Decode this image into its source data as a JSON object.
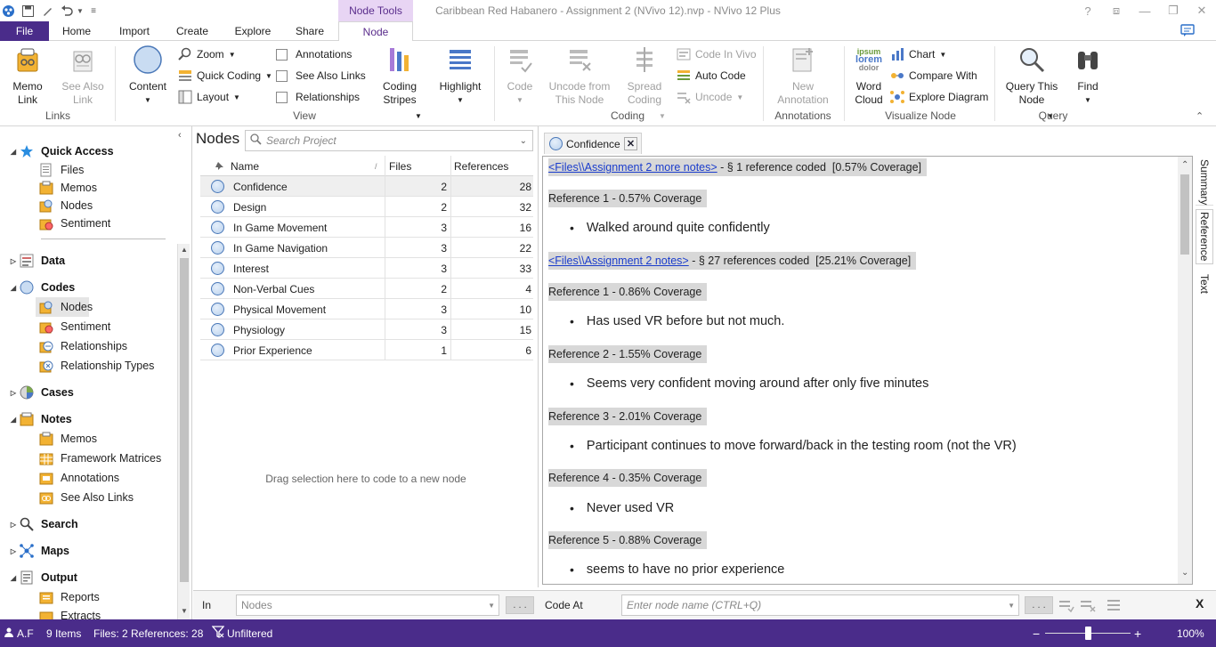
{
  "window": {
    "title": "Caribbean Red Habanero - Assignment 2 (NVivo 12).nvp - NVivo 12 Plus",
    "contextual_tab_group": "Node Tools",
    "controls": [
      "?",
      "⧈",
      "—",
      "❐",
      "✕"
    ]
  },
  "tabs": [
    "File",
    "Home",
    "Import",
    "Create",
    "Explore",
    "Share",
    "Node"
  ],
  "ribbon": {
    "links": {
      "memo_link": "Memo\nLink",
      "see_also_link": "See Also\nLink",
      "group": "Links"
    },
    "view": {
      "content": "Content",
      "zoom": "Zoom",
      "quick_coding": "Quick Coding",
      "layout": "Layout",
      "annotations": "Annotations",
      "see_also_links": "See Also Links",
      "relationships": "Relationships",
      "coding_stripes": "Coding\nStripes",
      "highlight": "Highlight",
      "group": "View"
    },
    "coding": {
      "code": "Code",
      "uncode_from": "Uncode from\nThis Node",
      "spread_coding": "Spread\nCoding",
      "code_in_vivo": "Code In Vivo",
      "auto_code": "Auto Code",
      "uncode": "Uncode",
      "group": "Coding"
    },
    "annotations": {
      "new_annotation": "New\nAnnotation",
      "group": "Annotations"
    },
    "visualize": {
      "word_cloud": "Word\nCloud",
      "chart": "Chart",
      "compare_with": "Compare With",
      "explore_diagram": "Explore Diagram",
      "group": "Visualize Node",
      "wordcloud_words": [
        "ipsum",
        "lorem",
        "dolor"
      ]
    },
    "query": {
      "query_this_node": "Query This\nNode",
      "find": "Find",
      "group": "Query"
    }
  },
  "nav": {
    "sections": [
      {
        "label": "Quick Access",
        "expanded": true,
        "icon": "star-icon",
        "items": [
          "Files",
          "Memos",
          "Nodes",
          "Sentiment"
        ]
      },
      {
        "label": "Data",
        "expanded": false,
        "icon": "data-icon",
        "items": []
      },
      {
        "label": "Codes",
        "expanded": true,
        "icon": "codes-icon",
        "items": [
          "Nodes",
          "Sentiment",
          "Relationships",
          "Relationship Types"
        ]
      },
      {
        "label": "Cases",
        "expanded": false,
        "icon": "cases-icon",
        "items": []
      },
      {
        "label": "Notes",
        "expanded": true,
        "icon": "notes-icon",
        "items": [
          "Memos",
          "Framework Matrices",
          "Annotations",
          "See Also Links"
        ]
      },
      {
        "label": "Search",
        "expanded": false,
        "icon": "search-icon",
        "items": []
      },
      {
        "label": "Maps",
        "expanded": false,
        "icon": "maps-icon",
        "items": []
      },
      {
        "label": "Output",
        "expanded": true,
        "icon": "output-icon",
        "items": [
          "Reports",
          "Extracts"
        ]
      }
    ]
  },
  "nodes": {
    "title": "Nodes",
    "search_placeholder": "Search Project",
    "columns": [
      "Name",
      "Files",
      "References"
    ],
    "rows": [
      {
        "name": "Confidence",
        "files": "2",
        "references": "28"
      },
      {
        "name": "Design",
        "files": "2",
        "references": "32"
      },
      {
        "name": "In Game Movement",
        "files": "3",
        "references": "16"
      },
      {
        "name": "In Game Navigation",
        "files": "3",
        "references": "22"
      },
      {
        "name": "Interest",
        "files": "3",
        "references": "33"
      },
      {
        "name": "Non-Verbal Cues",
        "files": "2",
        "references": "4"
      },
      {
        "name": "Physical Movement",
        "files": "3",
        "references": "10"
      },
      {
        "name": "Physiology",
        "files": "3",
        "references": "15"
      },
      {
        "name": "Prior Experience",
        "files": "1",
        "references": "6"
      }
    ],
    "drag_hint": "Drag selection here to code to a new node"
  },
  "detail": {
    "tab_label": "Confidence",
    "side_tabs": [
      "Summary",
      "Reference",
      "Text"
    ],
    "blocks": [
      {
        "type": "file",
        "link": "<Files\\\\Assignment 2 more notes>",
        "text": " - § 1 reference coded  [0.57% Coverage]"
      },
      {
        "type": "ref",
        "text": "Reference 1 - 0.57% Coverage"
      },
      {
        "type": "bullet",
        "text": "Walked around quite confidently"
      },
      {
        "type": "file",
        "link": "<Files\\\\Assignment 2 notes>",
        "text": " - § 27 references coded  [25.21% Coverage]"
      },
      {
        "type": "ref",
        "text": "Reference 1 - 0.86% Coverage"
      },
      {
        "type": "bullet",
        "text": "Has used VR before but not much."
      },
      {
        "type": "ref",
        "text": "Reference 2 - 1.55% Coverage"
      },
      {
        "type": "bullet",
        "text": "Seems very confident moving around after only five minutes"
      },
      {
        "type": "ref",
        "text": "Reference 3 - 2.01% Coverage"
      },
      {
        "type": "bullet",
        "text": "Participant continues to move forward/back in the testing room (not the VR)"
      },
      {
        "type": "ref",
        "text": "Reference 4 - 0.35% Coverage"
      },
      {
        "type": "bullet",
        "text": "Never used VR"
      },
      {
        "type": "ref",
        "text": "Reference 5 - 0.88% Coverage"
      },
      {
        "type": "bullet",
        "text": "seems to have no prior experience"
      }
    ]
  },
  "codebar": {
    "in_label": "In",
    "in_value": "Nodes",
    "dots": ". . .",
    "code_at_label": "Code At",
    "code_at_placeholder": "Enter node name (CTRL+Q)",
    "close": "X"
  },
  "status": {
    "user": "A.F",
    "items": "9 Items",
    "files_refs": "Files: 2  References: 28",
    "filter": "Unfiltered",
    "zoom": "100%",
    "zoom_level": 0.5
  },
  "colors": {
    "accent": "#4a2c8a",
    "tool_tab": "#e8d5f4",
    "link": "#1a3ccc"
  }
}
